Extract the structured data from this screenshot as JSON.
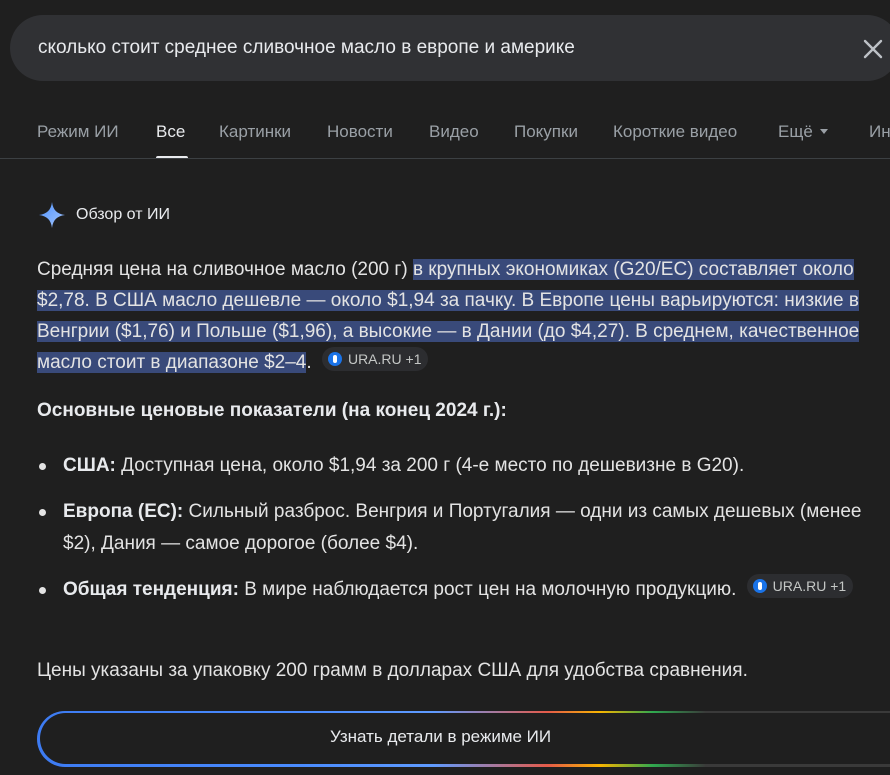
{
  "search": {
    "query": "сколько стоит среднее сливочное масло в европе и америке",
    "clear_icon": "close-icon"
  },
  "tabs": [
    {
      "label": "Режим ИИ",
      "active": false
    },
    {
      "label": "Все",
      "active": true
    },
    {
      "label": "Картинки",
      "active": false
    },
    {
      "label": "Новости",
      "active": false
    },
    {
      "label": "Видео",
      "active": false
    },
    {
      "label": "Покупки",
      "active": false
    },
    {
      "label": "Короткие видео",
      "active": false
    },
    {
      "label": "Ещё",
      "active": false
    },
    {
      "label": "Ин",
      "active": false
    }
  ],
  "ai_overview": {
    "title": "Обзор от ИИ",
    "intro_plain": "Средняя цена на сливочное масло (200 г) ",
    "intro_highlight": "в крупных экономиках (G20/ЕС) составляет около $2,78. В США масло дешевле — около $1,94 за пачку. В Европе цены варьируются: низкие в Венгрии ($1,76) и Польше ($1,96), а высокие — в Дании (до $4,27). В среднем, качественное масло стоит в диапазоне $2–4",
    "intro_end": ".",
    "source_chip": "URA.RU +1",
    "heading": "Основные ценовые показатели (на конец 2024 г.):",
    "bullets": [
      {
        "term": "США:",
        "text": " Доступная цена, около $1,94 за 200 г (4-е место по дешевизне в G20)."
      },
      {
        "term": "Европа (ЕС):",
        "text": " Сильный разброс. Венгрия и Португалия — одни из самых дешевых (менее $2), Дания — самое дорогое (более $4)."
      },
      {
        "term": "Общая тенденция:",
        "text": " В мире наблюдается рост цен на молочную продукцию.",
        "chip": "URA.RU +1"
      }
    ],
    "footer": "Цены указаны за упаковку 200 грамм в долларах США для удобства сравнения.",
    "ai_mode_button": "Узнать детали в режиме ИИ"
  },
  "colors": {
    "background": "#1f1f1f",
    "search_bg": "#303134",
    "highlight": "#394a7a",
    "accent_blue": "#1a73e8"
  }
}
